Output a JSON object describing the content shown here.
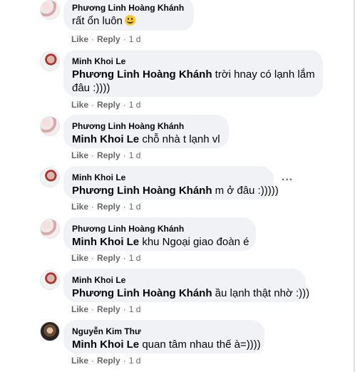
{
  "actions": {
    "like": "Like",
    "reply": "Reply",
    "sep": "·",
    "time": "1 d"
  },
  "comments": [
    {
      "author": "Phương Linh Hoàng Khánh",
      "tag": "",
      "text": "rất ổn luôn",
      "emoji": "smile-emoji"
    },
    {
      "author": "Minh Khoi Le",
      "tag": "Phương Linh Hoàng Khánh",
      "text": " trời hnay có lạnh lắm",
      "text2": "đâu :))))"
    },
    {
      "author": "Phương Linh Hoàng Khánh",
      "tag": "Minh Khoi Le",
      "text": " chỗ nhà t lạnh vl"
    },
    {
      "author": "Minh Khoi Le",
      "tag": "Phương Linh Hoàng Khánh",
      "text": " m ở đâu :)))))",
      "more": "···"
    },
    {
      "author": "Phương Linh Hoàng Khánh",
      "tag": "Minh Khoi Le",
      "text": " khu Ngoại giao đoàn é"
    },
    {
      "author": "Minh Khoi Le",
      "tag": "Phương Linh Hoàng Khánh",
      "text": " ầu lạnh thật nhờ :)))"
    },
    {
      "author": "Nguyễn Kim Thư",
      "tag": "Minh Khoi Le",
      "text": " quan tâm nhau thế à=))))"
    }
  ]
}
